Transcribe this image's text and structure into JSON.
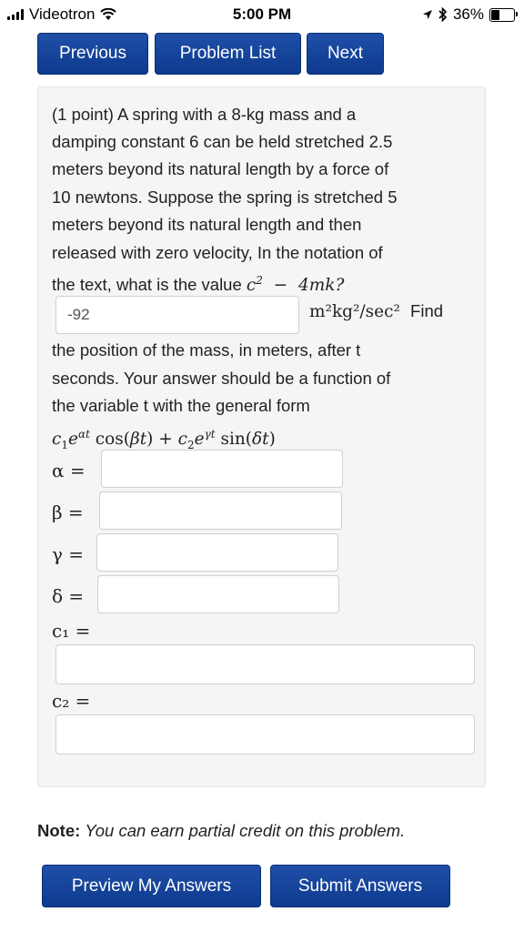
{
  "status": {
    "carrier": "Videotron",
    "time": "5:00 PM",
    "battery": "36%",
    "battery_level": 0.36
  },
  "nav": {
    "previous": "Previous",
    "problem_list": "Problem List",
    "next": "Next"
  },
  "problem": {
    "line1": "(1 point) A spring with a 8-kg mass and a",
    "line2": "damping constant 6 can be held stretched 2.5",
    "line3": "meters beyond its natural length by a force of",
    "line4": "10 newtons. Suppose the spring is stretched 5",
    "line5": "meters beyond its natural length and then",
    "line6": "released with zero velocity, In the notation of",
    "line7": "the text, what is the value",
    "units": "m²kg²/sec²",
    "find": "Find",
    "line8": "the position of the mass, in meters, after t",
    "line9": "seconds. Your answer should be a function of",
    "line10": "the variable t with the general form"
  },
  "answers": {
    "discriminant": "-92",
    "alpha": "",
    "beta": "",
    "gamma": "",
    "delta": "",
    "c1": "",
    "c2": ""
  },
  "labels": {
    "alpha": "α =",
    "beta": "β =",
    "gamma": "γ =",
    "delta": "δ =",
    "c1": "c₁ =",
    "c2": "c₂ ="
  },
  "note": {
    "bold": "Note:",
    "text": "You can earn partial credit on this problem."
  },
  "footer": {
    "preview": "Preview My Answers",
    "submit": "Submit Answers"
  }
}
